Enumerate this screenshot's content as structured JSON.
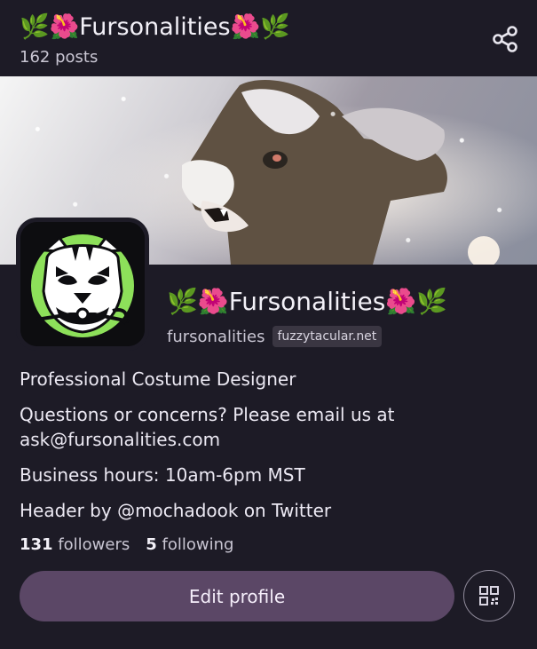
{
  "top_bar": {
    "title_prefix_emoji": "🌿🌺",
    "title": "Fursonalities",
    "title_suffix_emoji": "🌺🌿",
    "posts_count": "162 posts",
    "share_icon": "share-icon"
  },
  "profile": {
    "display_name_prefix_emoji": "🌿🌺",
    "display_name": "Fursonalities",
    "display_name_suffix_emoji": "🌺🌿",
    "handle": "fursonalities",
    "instance": "fuzzytacular.net"
  },
  "bio": {
    "line1": "Professional Costume Designer",
    "line2": "Questions or concerns? Please email us at ask@fursonalities.com",
    "line3": "Business hours: 10am-6pm MST",
    "line4": "Header by @mochadook on Twitter"
  },
  "stats": {
    "followers_count": "131",
    "followers_label": "followers",
    "following_count": "5",
    "following_label": "following"
  },
  "actions": {
    "edit_profile": "Edit profile",
    "qr_icon": "qr-code-icon"
  },
  "colors": {
    "background": "#1d1b26",
    "button": "#5b4766",
    "avatar_accent": "#8de05a"
  }
}
